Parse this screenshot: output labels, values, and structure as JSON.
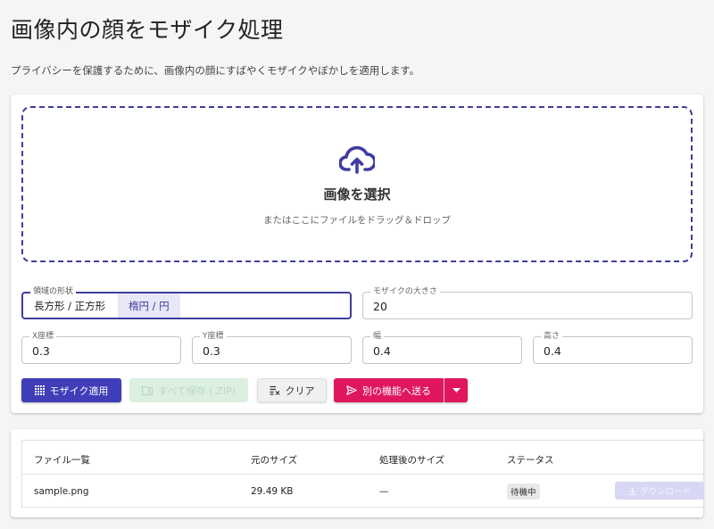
{
  "page": {
    "title": "画像内の顔をモザイク処理",
    "description": "プライバシーを保護するために、画像内の顔にすばやくモザイクやぼかしを適用します。"
  },
  "dropzone": {
    "icon": "cloud-upload-icon",
    "title": "画像を選択",
    "hint": "またはここにファイルをドラッグ＆ドロップ",
    "accent_color": "#3f3d9e"
  },
  "settings": {
    "shape": {
      "label": "領域の形状",
      "options": [
        "長方形 / 正方形",
        "楕円 / 円"
      ],
      "selected": "楕円 / 円"
    },
    "mosaic_size": {
      "label": "モザイクの大きさ",
      "value": "20"
    },
    "x": {
      "label": "X座標",
      "value": "0.3"
    },
    "y": {
      "label": "Y座標",
      "value": "0.3"
    },
    "width": {
      "label": "幅",
      "value": "0.4"
    },
    "height": {
      "label": "高さ",
      "value": "0.4"
    }
  },
  "actions": {
    "apply": {
      "label": "モザイク適用",
      "icon": "mosaic-grid-icon",
      "color": "#3f3db8"
    },
    "save_all": {
      "label": "すべて保存 (.ZIP)",
      "icon": "folder-zip-icon",
      "disabled": true
    },
    "clear": {
      "label": "クリア",
      "icon": "clear-list-icon"
    },
    "send": {
      "label": "別の機能へ送る",
      "icon": "send-icon",
      "dropdown_icon": "caret-down-icon",
      "color": "#e0175f"
    }
  },
  "files": {
    "headers": [
      "ファイル一覧",
      "元のサイズ",
      "処理後のサイズ",
      "ステータス"
    ],
    "rows": [
      {
        "name": "sample.png",
        "original_size": "29.49 KB",
        "processed_size": "—",
        "status": "待機中",
        "download_label": "ダウンロード"
      }
    ]
  }
}
